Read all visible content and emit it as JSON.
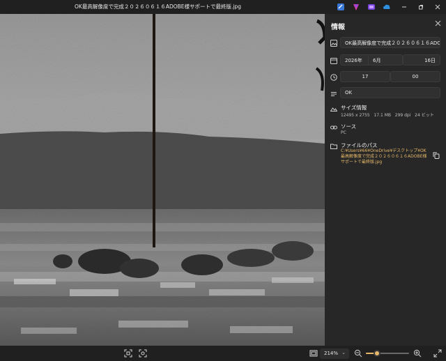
{
  "window": {
    "title": "OK最高解像度で完成２０２６０６１６ADOBE様サポートで最終版.jpg"
  },
  "panel": {
    "header": "情報",
    "filename": "OK最高解像度で完成２０２６０６１６ADOBE様サポートで最終版",
    "date": {
      "year": "2026年",
      "month": "6月",
      "day": "16日"
    },
    "time": {
      "hour": "17",
      "minute": "00"
    },
    "caption": "OK",
    "size": {
      "title": "サイズ情報",
      "dimensions": "12495 x 2755",
      "filesize": "17.1 MB",
      "dpi": "299 dpi",
      "bitdepth": "24 ビット"
    },
    "source": {
      "title": "ソース",
      "value": "PC"
    },
    "path": {
      "title": "ファイルのパス",
      "value": "C:¥Users¥66¥OneDrive¥デスクトップ¥OK最高解像度で完成２０２６０６１６ADOBE様サポートで最終版.jpg"
    }
  },
  "bottom": {
    "zoom": "214%",
    "zoom_fraction": 0.25
  },
  "colors": {
    "accent": "#e8b96a",
    "panel_bg": "#272727",
    "titlebar_bg": "#202020"
  }
}
